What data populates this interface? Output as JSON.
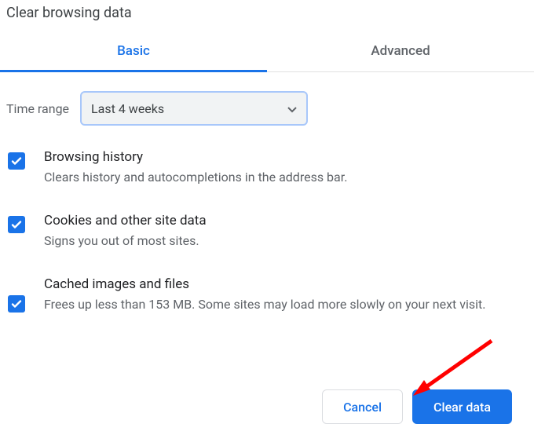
{
  "dialog": {
    "title": "Clear browsing data",
    "tabs": {
      "basic": "Basic",
      "advanced": "Advanced"
    },
    "time_range": {
      "label": "Time range",
      "selected": "Last 4 weeks"
    },
    "items": [
      {
        "title": "Browsing history",
        "desc": "Clears history and autocompletions in the address bar."
      },
      {
        "title": "Cookies and other site data",
        "desc": "Signs you out of most sites."
      },
      {
        "title": "Cached images and files",
        "desc": "Frees up less than 153 MB. Some sites may load more slowly on your next visit."
      }
    ],
    "buttons": {
      "cancel": "Cancel",
      "clear": "Clear data"
    }
  }
}
